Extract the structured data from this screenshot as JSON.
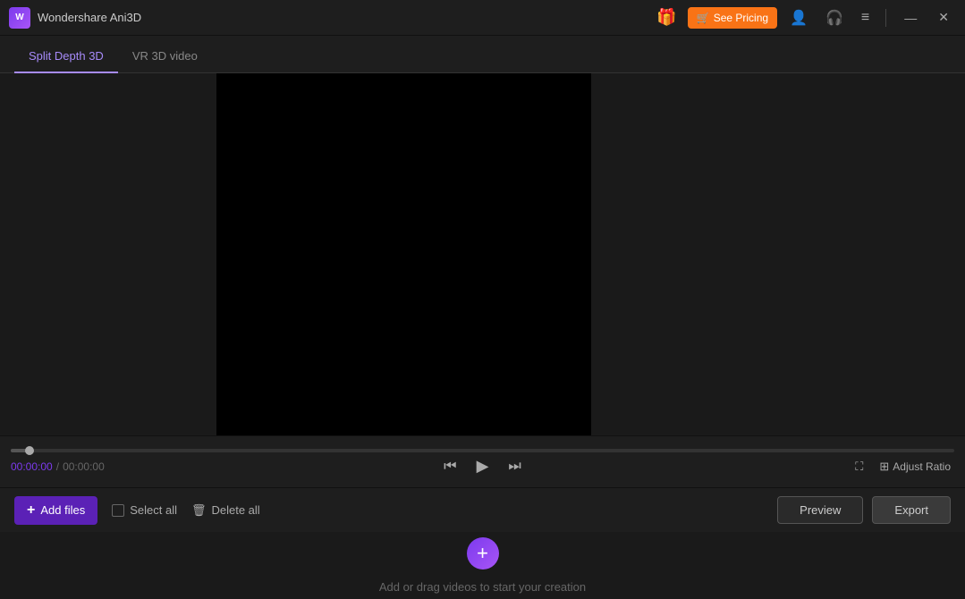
{
  "titlebar": {
    "logo_text": "W",
    "app_name": "Wondershare Ani3D",
    "gift_icon": "🎁",
    "see_pricing_icon": "🛒",
    "see_pricing_label": "See Pricing",
    "account_icon": "👤",
    "headphone_icon": "🎧",
    "menu_icon": "≡",
    "minimize_icon": "—",
    "close_icon": "✕"
  },
  "tabs": [
    {
      "id": "split-depth-3d",
      "label": "Split Depth 3D",
      "active": true
    },
    {
      "id": "vr-3d-video",
      "label": "VR 3D video",
      "active": false
    }
  ],
  "playback": {
    "time_current": "00:00:00",
    "time_separator": "/",
    "time_total": "00:00:00",
    "skip_back_icon": "⏮",
    "play_icon": "▶",
    "skip_forward_icon": "⏭",
    "fullscreen_icon": "⛶",
    "adjust_ratio_icon": "⊞",
    "adjust_ratio_label": "Adjust Ratio"
  },
  "toolbar": {
    "add_files_icon": "+",
    "add_files_label": "Add files",
    "select_all_label": "Select all",
    "delete_all_icon": "🗑",
    "delete_all_label": "Delete all",
    "preview_label": "Preview",
    "export_label": "Export"
  },
  "dropzone": {
    "add_icon": "+",
    "message": "Add or drag videos to start your creation"
  }
}
